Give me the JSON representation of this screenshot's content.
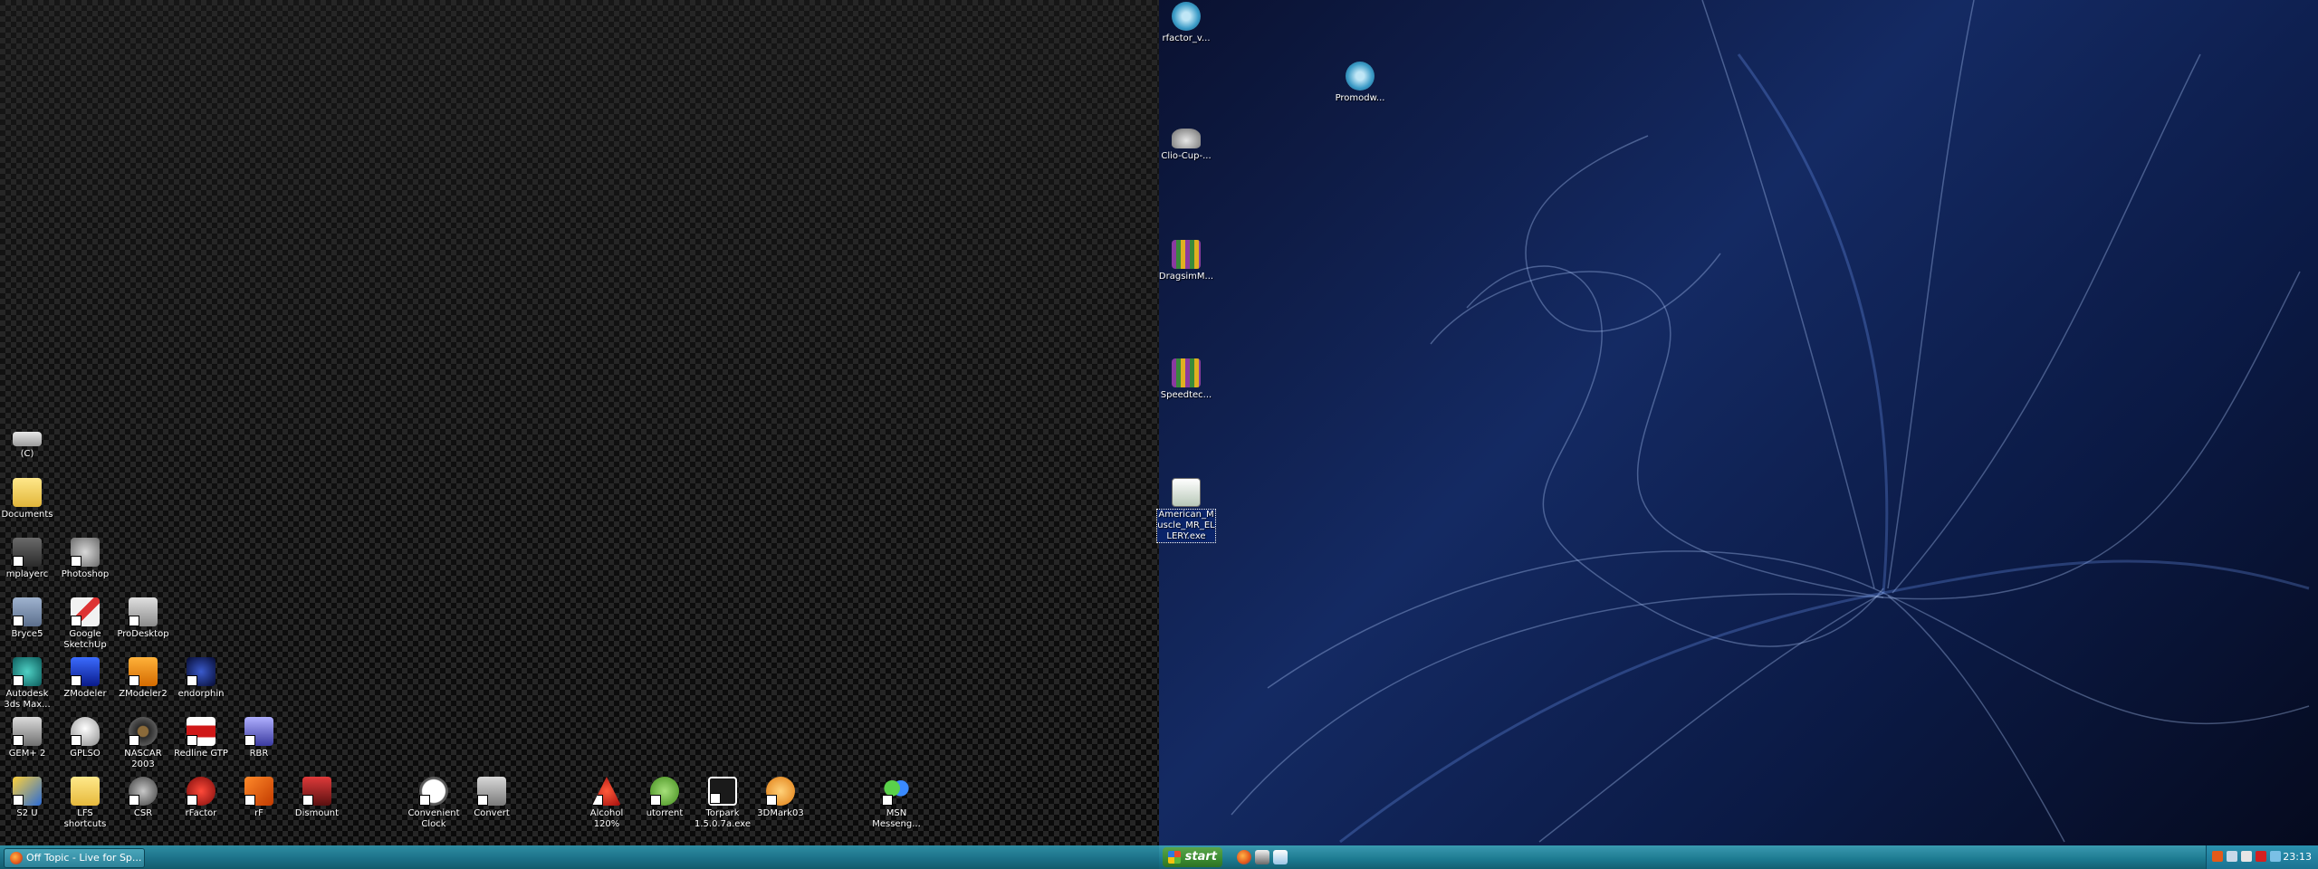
{
  "desktop_left_icons": [
    {
      "key": "c_drive",
      "label": "(C)",
      "icon": "drive-icon"
    },
    {
      "key": "documents",
      "label": "Documents",
      "icon": "folder-documents-icon"
    },
    {
      "key": "mplayerc",
      "label": "mplayerc",
      "icon": "media-player-icon"
    },
    {
      "key": "photoshop",
      "label": "Photoshop",
      "icon": "photoshop-icon"
    },
    {
      "key": "bryce5",
      "label": "Bryce5",
      "icon": "bryce-icon"
    },
    {
      "key": "sketchup",
      "label": "Google SketchUp",
      "icon": "sketchup-icon"
    },
    {
      "key": "prodesktop",
      "label": "ProDesktop",
      "icon": "prodesktop-icon"
    },
    {
      "key": "autodesk",
      "label": "Autodesk 3ds Max...",
      "icon": "3dsmax-icon"
    },
    {
      "key": "zmodeler",
      "label": "ZModeler",
      "icon": "zmodeler-icon"
    },
    {
      "key": "zmodeler2",
      "label": "ZModeler2",
      "icon": "zmodeler2-icon"
    },
    {
      "key": "endorphin",
      "label": "endorphin",
      "icon": "endorphin-icon"
    },
    {
      "key": "gem2",
      "label": "GEM+ 2",
      "icon": "gem-icon"
    },
    {
      "key": "gplso",
      "label": "GPLSO",
      "icon": "helmet-icon"
    },
    {
      "key": "nascar",
      "label": "NASCAR 2003",
      "icon": "tire-icon"
    },
    {
      "key": "redline",
      "label": "Redline GTP",
      "icon": "redline-icon"
    },
    {
      "key": "rbr",
      "label": "RBR",
      "icon": "rally-car-icon"
    },
    {
      "key": "s2u",
      "label": "S2 U",
      "icon": "s2u-icon"
    },
    {
      "key": "lfs",
      "label": "LFS shortcuts",
      "icon": "folder-icon"
    },
    {
      "key": "csr",
      "label": "CSR",
      "icon": "csr-icon"
    },
    {
      "key": "rfactor",
      "label": "rFactor",
      "icon": "rfactor-icon"
    },
    {
      "key": "rf",
      "label": "rF",
      "icon": "rf-icon"
    },
    {
      "key": "dismount",
      "label": "Dismount",
      "icon": "dismount-icon"
    },
    {
      "key": "clock",
      "label": "Convenient Clock",
      "icon": "clock-icon"
    },
    {
      "key": "convert",
      "label": "Convert",
      "icon": "convert-icon"
    },
    {
      "key": "alcohol",
      "label": "Alcohol 120%",
      "icon": "alcohol-icon"
    },
    {
      "key": "utorrent",
      "label": "utorrent",
      "icon": "utorrent-icon"
    },
    {
      "key": "torpark",
      "label": "Torpark 1.5.0.7a.exe",
      "icon": "7z-icon"
    },
    {
      "key": "3dmark",
      "label": "3DMark03",
      "icon": "3dmark-icon"
    },
    {
      "key": "msn",
      "label": "MSN Messeng...",
      "icon": "msn-messenger-icon"
    }
  ],
  "desktop_right_icons": [
    {
      "key": "rfactor_v",
      "label": "rfactor_v...",
      "icon": "cd-globe-icon"
    },
    {
      "key": "promodw",
      "label": "Promodw...",
      "icon": "cd-globe-icon"
    },
    {
      "key": "clio",
      "label": "Clio-Cup-...",
      "icon": "car-icon"
    },
    {
      "key": "dragsim",
      "label": "DragsimM...",
      "icon": "archive-icon"
    },
    {
      "key": "speedtec",
      "label": "Speedtec...",
      "icon": "archive-icon"
    },
    {
      "key": "american",
      "label": "American_Muscle_MR_ELLERY.exe",
      "icon": "installer-icon"
    }
  ],
  "taskbar": {
    "task_button": "Off Topic - Live for Sp...",
    "start_label": "start",
    "clock": "23:13"
  }
}
